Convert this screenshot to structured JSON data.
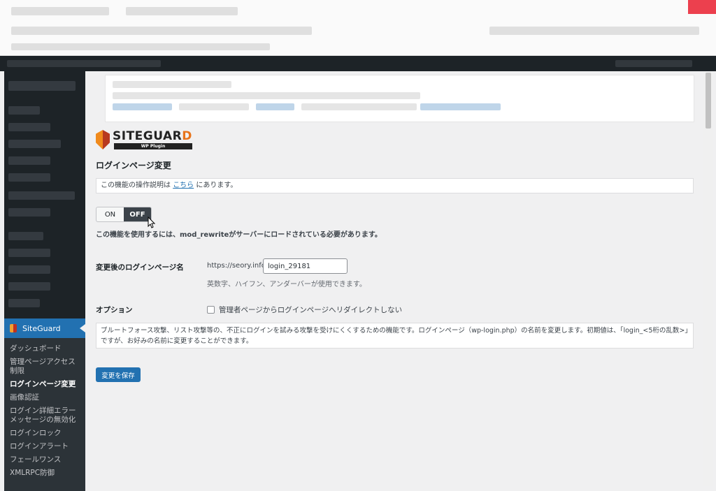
{
  "sidebar": {
    "plugin_label": "SiteGuard",
    "items": [
      "ダッシュボード",
      "管理ページアクセス制限",
      "ログインページ変更",
      "画像認証",
      "ログイン詳細エラーメッセージの無効化",
      "ログインロック",
      "ログインアラート",
      "フェールワンス",
      "XMLRPC防御"
    ]
  },
  "logo": {
    "word_main": "SITEGUAR",
    "word_accent": "D",
    "sub": "WP Plugin"
  },
  "page": {
    "title": "ログインページ変更",
    "info_prefix": "この機能の操作説明は ",
    "info_link": "こちら",
    "info_suffix": " にあります。",
    "toggle": {
      "on_label": "ON",
      "off_label": "OFF",
      "selected": "OFF"
    },
    "rewrite_note": "この機能を使用するには、mod_rewriteがサーバーにロードされている必要があります。",
    "slug_label": "変更後のログインページ名",
    "url_prefix": "https://seory.info/",
    "slug_value": "login_29181",
    "slug_hint": "英数字、ハイフン、アンダーバーが使用できます。",
    "option_label": "オプション",
    "redirect_checkbox": "管理者ページからログインページへリダイレクトしない",
    "description": "ブルートフォース攻撃、リスト攻撃等の、不正にログインを試みる攻撃を受けにくくするための機能です。ログインページ（wp-login.php）の名前を変更します。初期値は、「login_<5桁の乱数>」ですが、お好みの名前に変更することができます。",
    "save_label": "変更を保存"
  },
  "colors": {
    "admin_dark": "#1d2327",
    "accent_blue": "#2271b1",
    "logo_orange": "#e8731a"
  }
}
